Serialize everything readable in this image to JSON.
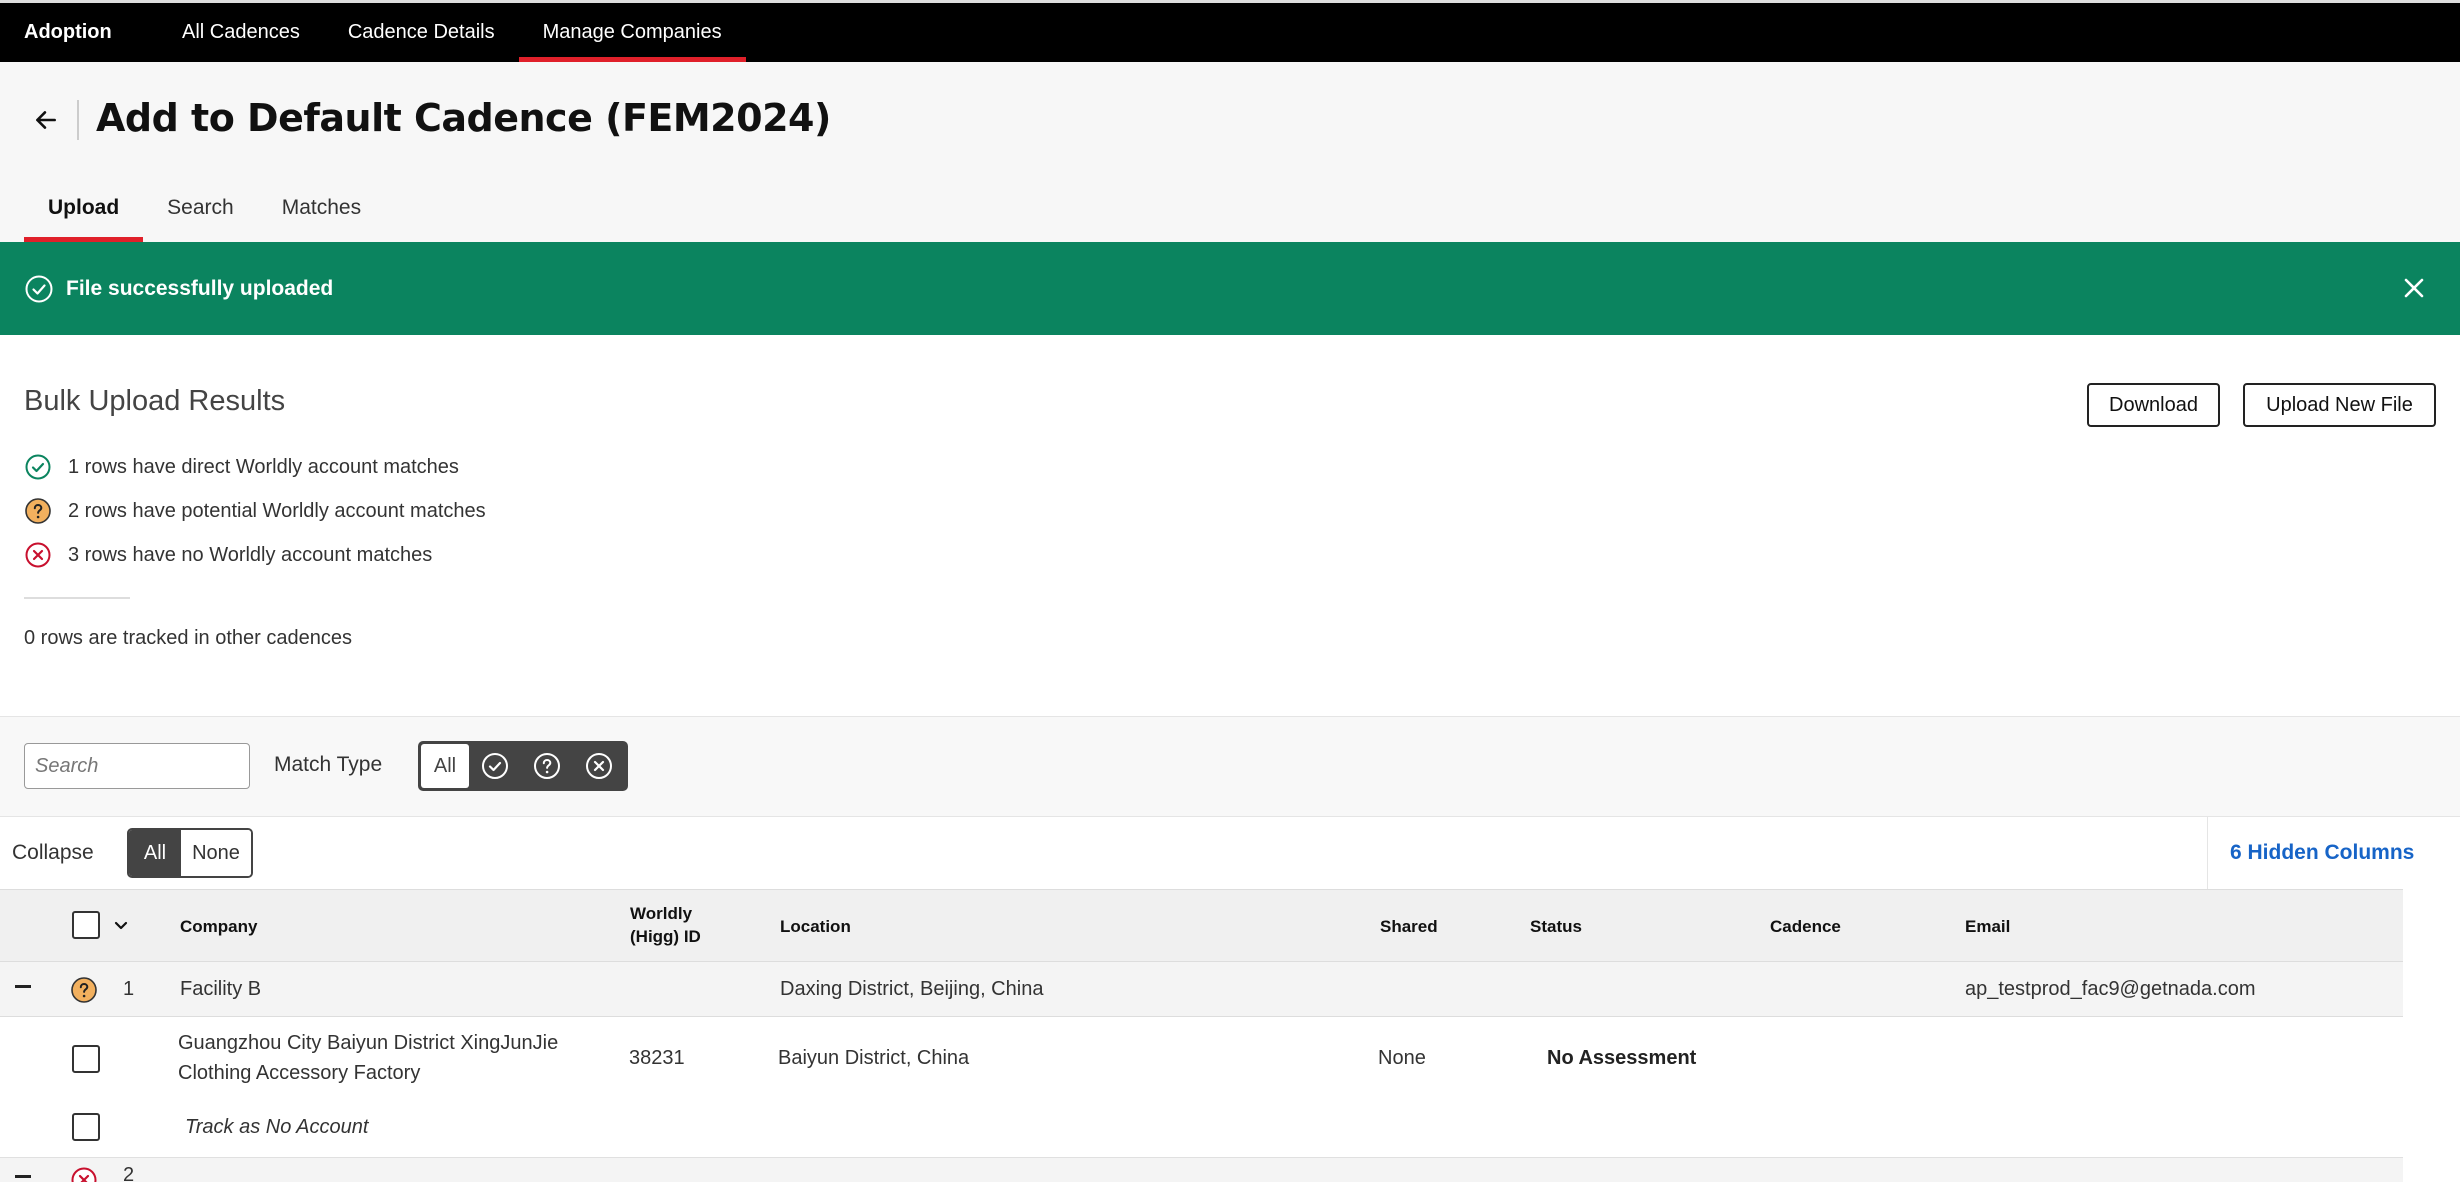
{
  "topnav": {
    "brand": "Adoption",
    "items": [
      {
        "label": "All Cadences"
      },
      {
        "label": "Cadence Details"
      },
      {
        "label": "Manage Companies"
      }
    ]
  },
  "header": {
    "title": "Add to Default Cadence (FEM2024)",
    "tabs": [
      {
        "label": "Upload"
      },
      {
        "label": "Search"
      },
      {
        "label": "Matches"
      }
    ]
  },
  "banner": {
    "message": "File successfully uploaded",
    "color": "#0b845f"
  },
  "results": {
    "title": "Bulk Upload Results",
    "download_label": "Download",
    "upload_label": "Upload New File",
    "stats": [
      {
        "text": "1 rows have direct Worldly account matches",
        "icon": "check-circle-icon",
        "color": "#0b845f"
      },
      {
        "text": "2 rows have potential Worldly account matches",
        "icon": "question-circle-icon",
        "color": "#f2b05e"
      },
      {
        "text": "3 rows have no Worldly account matches",
        "icon": "x-circle-icon",
        "color": "#c8102e"
      }
    ],
    "tracked": "0 rows are tracked in other cadences"
  },
  "filter": {
    "search_placeholder": "Search",
    "match_type_label": "Match Type",
    "all_label": "All"
  },
  "collapse": {
    "label": "Collapse",
    "all_label": "All",
    "none_label": "None",
    "hidden_columns": "6 Hidden Columns"
  },
  "table": {
    "columns": {
      "company": "Company",
      "worldly_id_line1": "Worldly",
      "worldly_id_line2": "(Higg) ID",
      "location": "Location",
      "shared": "Shared",
      "status": "Status",
      "cadence": "Cadence",
      "email": "Email"
    },
    "groups": [
      {
        "index": "1",
        "company": "Facility B",
        "location": "Daxing District, Beijing, China",
        "email": "ap_testprod_fac9@getnada.com",
        "child": {
          "company_line1": "Guangzhou City Baiyun District XingJunJie",
          "company_line2": "Clothing Accessory Factory",
          "worldly_id": "38231",
          "location": "Baiyun District, China",
          "shared": "None",
          "status": "No Assessment"
        },
        "track_label": "Track as No Account"
      },
      {
        "index": "2"
      }
    ]
  }
}
